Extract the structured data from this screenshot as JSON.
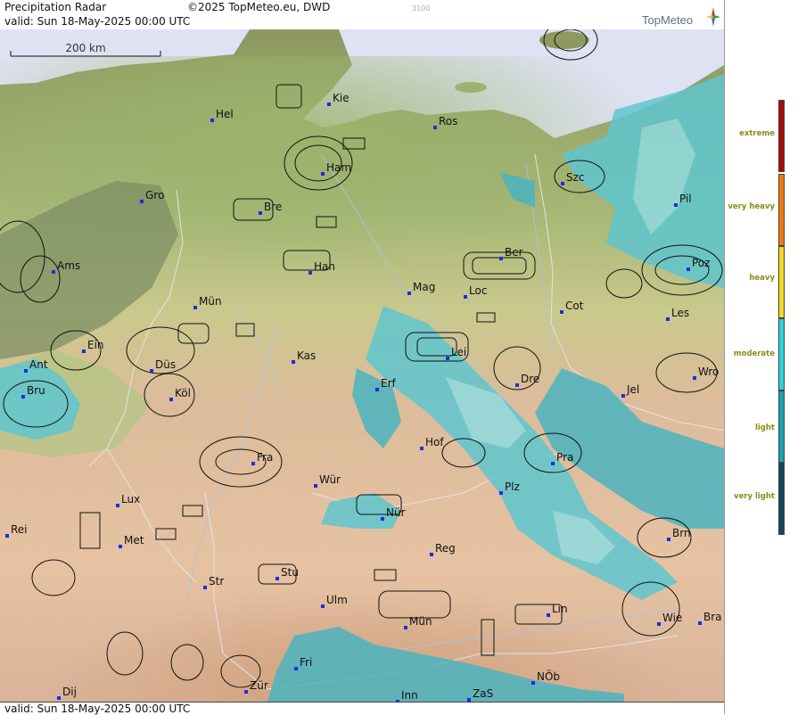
{
  "header": {
    "title": "Precipitation Radar",
    "copyright": "©2025 TopMeteo.eu, DWD",
    "valid": "valid:  Sun  18-May-2025 00:00 UTC",
    "code": "3100",
    "logo": "TopMeteo"
  },
  "scale": {
    "label": "200 km"
  },
  "footer": {
    "valid": "valid:  Sun  18-May-2025 00:00 UTC"
  },
  "legend": [
    {
      "label": "extreme",
      "color": "#a80a0a"
    },
    {
      "label": "very heavy",
      "color": "#f07a10"
    },
    {
      "label": "heavy",
      "color": "#f6d81c"
    },
    {
      "label": "moderate",
      "color": "#2ad4d8"
    },
    {
      "label": "light",
      "color": "#18a2b2"
    },
    {
      "label": "very light",
      "color": "#0f4a5c"
    }
  ],
  "cities": [
    {
      "name": "Kie"
    },
    {
      "name": "Hel"
    },
    {
      "name": "Ros"
    },
    {
      "name": "Ham"
    },
    {
      "name": "Szc"
    },
    {
      "name": "Gro"
    },
    {
      "name": "Bre"
    },
    {
      "name": "Pil"
    },
    {
      "name": "Ber"
    },
    {
      "name": "Ams"
    },
    {
      "name": "Han"
    },
    {
      "name": "Poz"
    },
    {
      "name": "Mag"
    },
    {
      "name": "Loc"
    },
    {
      "name": "Mün"
    },
    {
      "name": "Cot"
    },
    {
      "name": "Les"
    },
    {
      "name": "Ein"
    },
    {
      "name": "Kas"
    },
    {
      "name": "Lei"
    },
    {
      "name": "Ant"
    },
    {
      "name": "Düs"
    },
    {
      "name": "Dre"
    },
    {
      "name": "Wro"
    },
    {
      "name": "Bru"
    },
    {
      "name": "Köl"
    },
    {
      "name": "Erf"
    },
    {
      "name": "Jel"
    },
    {
      "name": "Hof"
    },
    {
      "name": "Fra"
    },
    {
      "name": "Pra"
    },
    {
      "name": "Wür"
    },
    {
      "name": "Plz"
    },
    {
      "name": "Lux"
    },
    {
      "name": "Nür"
    },
    {
      "name": "Rei"
    },
    {
      "name": "Met"
    },
    {
      "name": "Brn"
    },
    {
      "name": "Reg"
    },
    {
      "name": "Stu"
    },
    {
      "name": "Str"
    },
    {
      "name": "Ulm"
    },
    {
      "name": "Lin"
    },
    {
      "name": "Mün"
    },
    {
      "name": "Wie"
    },
    {
      "name": "Bra"
    },
    {
      "name": "Fri"
    },
    {
      "name": "NÖb"
    },
    {
      "name": "Dij"
    },
    {
      "name": "Zür"
    },
    {
      "name": "Inn"
    },
    {
      "name": "ZaS"
    }
  ]
}
